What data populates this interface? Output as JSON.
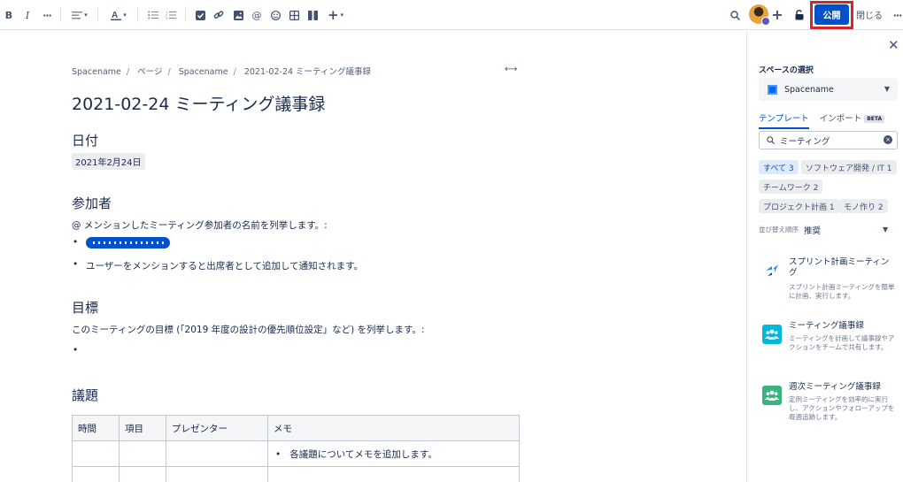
{
  "toolbar": {
    "bold_label": "B",
    "italic_label": "I",
    "more_format_label": "···",
    "insert_label": "+",
    "overflow_label": "···"
  },
  "header": {
    "publish_label": "公開",
    "close_label": "閉じる",
    "accent": "#0052cc",
    "highlight": "#d8242b"
  },
  "breadcrumb": [
    "Spacename",
    "ページ",
    "Spacename",
    "2021-02-24 ミーティング議事録"
  ],
  "page": {
    "title": "2021-02-24 ミーティング議事録",
    "date_heading": "日付",
    "date_value": "2021年2月24日",
    "participants_heading": "参加者",
    "participants_intro": "@ メンションしたミーティング参加者の名前を列挙します。:",
    "participants_bullet": "ユーザーをメンションすると出席者として追加して通知されます。",
    "goal_heading": "目標",
    "goal_intro": "このミーティングの目標 (「2019 年度の設計の優先順位設定」など) を列挙します。:",
    "agenda_heading": "議題",
    "table": {
      "headers": [
        "時間",
        "項目",
        "プレゼンター",
        "メモ"
      ],
      "row1_note": "各議題についてメモを追加します。"
    }
  },
  "panel": {
    "space_label": "スペースの選択",
    "space_name": "Spacename",
    "tab_templates": "テンプレート",
    "tab_import": "インポート",
    "beta": "BETA",
    "search_value": "ミーティング",
    "chips": [
      "すべて 3",
      "ソフトウェア開発 / IT 1",
      "チームワーク 2",
      "プロジェクト計画 1",
      "モノ作り 2"
    ],
    "sort_label": "並び替え順序",
    "sort_value": "推奨",
    "templates": [
      {
        "title": "スプリント計画ミーティング",
        "desc": "スプリント計画ミーティングを簡単に計画、実行します。",
        "icon": "sprint-icon",
        "color": "#2684ff"
      },
      {
        "title": "ミーティング議事録",
        "desc": "ミーティングを計画して議事録やアクションをチームで共有します。",
        "icon": "people-icon",
        "color": "#00b8d9"
      },
      {
        "title": "週次ミーティング議事録",
        "desc": "定例ミーティングを効率的に実行し、アクションやフォローアップを毎週追跡します。",
        "icon": "people-icon",
        "color": "#36b37e"
      }
    ]
  }
}
